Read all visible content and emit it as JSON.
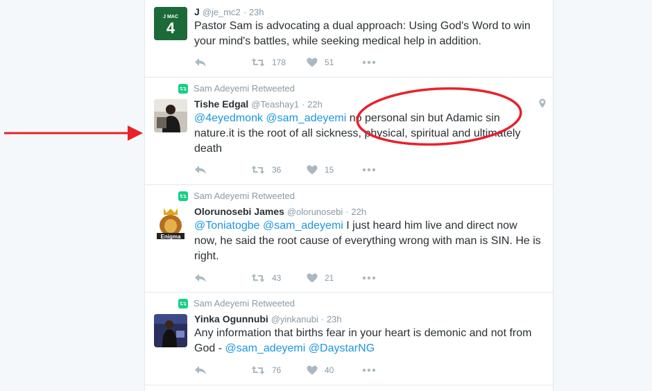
{
  "tweets": [
    {
      "name": "J",
      "handle": "@je_mc2",
      "time": "23h",
      "text": "Pastor Sam is advocating a dual approach: Using God's Word to win your mind's battles, while seeking medical help in addition.",
      "retweets": "178",
      "likes": "51",
      "avatar_text_top": "J MAC",
      "avatar_text_num": "4",
      "retweeted_by": ""
    },
    {
      "retweeted_by": "Sam Adeyemi Retweeted",
      "name": "Tishe Edgal",
      "handle": "@Teashay1",
      "time": "22h",
      "mention1": "@4eyedmonk",
      "mention2": "@sam_adeyemi",
      "text": " no personal sin but Adamic sin nature.it is the root of all sickness, physical, spiritual and ultimately death",
      "retweets": "36",
      "likes": "15"
    },
    {
      "retweeted_by": "Sam Adeyemi Retweeted",
      "name": "Olorunosebi James",
      "handle": "@olorunosebi",
      "time": "22h",
      "mention1": "@Toniatogbe",
      "mention2": "@sam_adeyemi",
      "text": " I just heard him live and direct now now, he said the root cause of everything wrong with man is SIN. He is right.",
      "retweets": "43",
      "likes": "21",
      "avatar_caption": "Enigma"
    },
    {
      "retweeted_by": "Sam Adeyemi Retweeted",
      "name": "Yinka Ogunnubi",
      "handle": "@yinkanubi",
      "time": "23h",
      "text": "Any information that births fear in your heart is demonic and not from God - ",
      "mention1": "@sam_adeyemi",
      "mention2": "@DaystarNG",
      "retweets": "76",
      "likes": "40"
    }
  ],
  "icons": {
    "reply": "reply-icon",
    "retweet": "retweet-icon",
    "like": "heart-icon",
    "more": "more-icon",
    "location": "location-pin-icon"
  },
  "colors": {
    "link": "#1b95e0",
    "retweet_badge": "#19cf86",
    "annotation": "#e8212a"
  }
}
